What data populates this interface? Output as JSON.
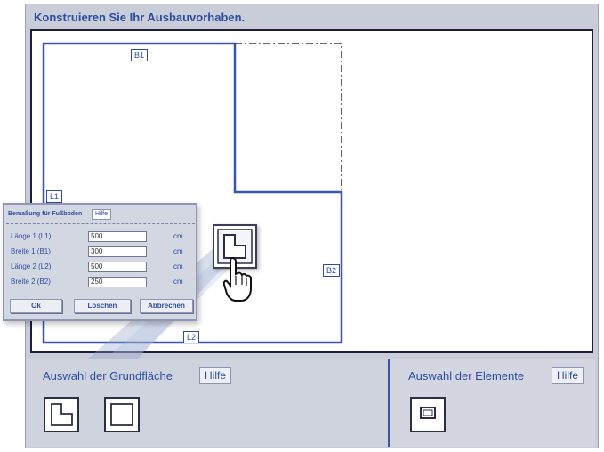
{
  "header": {
    "title": "Konstruieren Sie Ihr Ausbauvorhaben."
  },
  "plan": {
    "labels": {
      "b1": "B1",
      "l1": "L1",
      "b2": "B2",
      "l2": "L2"
    },
    "cursor_icon": "pointing-hand-icon",
    "dragged_tile_icon": "l-shape-floor-icon"
  },
  "dimension_dialog": {
    "title": "Bemaßung für Fußboden",
    "help": "Hilfe",
    "rows": [
      {
        "label": "Länge 1 (L1)",
        "value": "500",
        "unit": "cm"
      },
      {
        "label": "Breite 1 (B1)",
        "value": "300",
        "unit": "cm"
      },
      {
        "label": "Länge 2 (L2)",
        "value": "500",
        "unit": "cm"
      },
      {
        "label": "Breite 2 (B2)",
        "value": "250",
        "unit": "cm"
      }
    ],
    "buttons": {
      "ok": "Ok",
      "clear": "Löschen",
      "cancel": "Abbrechen"
    }
  },
  "floor_selection": {
    "title": "Auswahl der Grundfläche",
    "help": "Hilfe",
    "tiles": [
      "l-shape-floor-icon",
      "rectangle-floor-icon"
    ]
  },
  "element_selection": {
    "title": "Auswahl der Elemente",
    "help": "Hilfe",
    "tiles": [
      "window-element-icon"
    ]
  },
  "colors": {
    "accent": "#2d4da3",
    "panel": "#c9cdd8",
    "outline": "#3a55b0"
  }
}
